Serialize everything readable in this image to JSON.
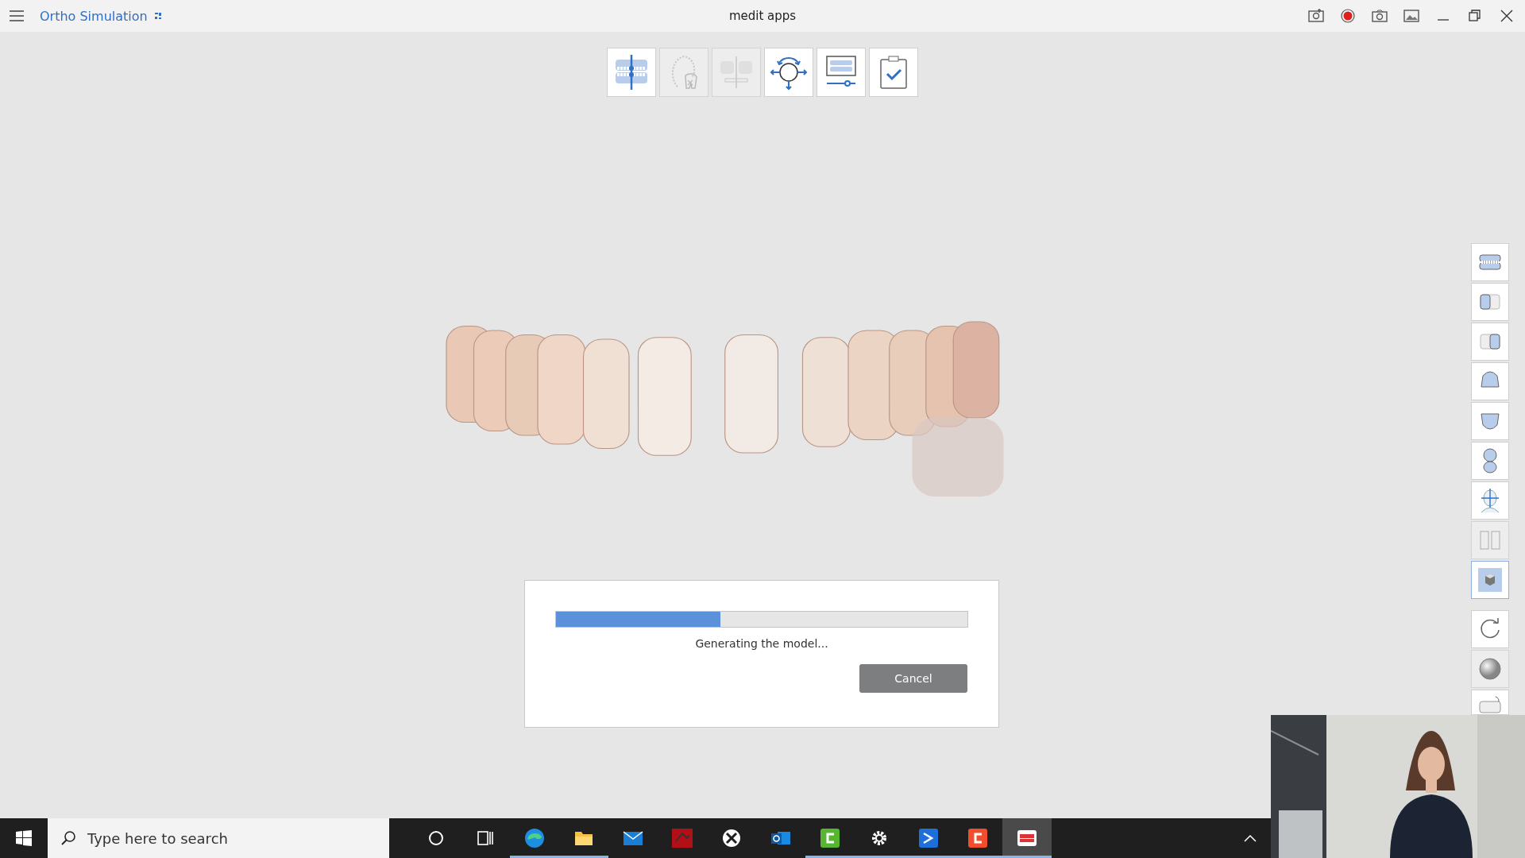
{
  "title_bar": {
    "app_name": "Ortho Simulation",
    "window_title": "medit apps"
  },
  "top_tools": [
    {
      "disabled": false
    },
    {
      "disabled": true
    },
    {
      "disabled": true
    },
    {
      "disabled": false
    },
    {
      "disabled": false
    },
    {
      "disabled": false
    }
  ],
  "view_tools": [
    {
      "selected": false,
      "disabled": false
    },
    {
      "selected": false,
      "disabled": false
    },
    {
      "selected": false,
      "disabled": false
    },
    {
      "selected": false,
      "disabled": false
    },
    {
      "selected": false,
      "disabled": false
    },
    {
      "selected": false,
      "disabled": false
    },
    {
      "selected": false,
      "disabled": false
    },
    {
      "selected": false,
      "disabled": true
    },
    {
      "selected": true,
      "disabled": false
    }
  ],
  "action_tools": [
    {
      "disabled": false
    },
    {
      "disabled": true
    },
    {
      "disabled": false
    }
  ],
  "progress_dialog": {
    "level": 0.4,
    "message": "Generating the model...",
    "cancel_button": "Cancel"
  },
  "taskbar": {
    "search": {
      "placeholder": "Type here to search"
    },
    "apps": [
      {
        "running": false,
        "selected": false
      },
      {
        "running": false,
        "selected": false
      },
      {
        "running": true,
        "selected": false
      },
      {
        "running": true,
        "selected": false
      },
      {
        "running": false,
        "selected": false
      },
      {
        "running": false,
        "selected": false
      },
      {
        "running": false,
        "selected": false
      },
      {
        "running": false,
        "selected": false
      },
      {
        "running": true,
        "selected": false
      },
      {
        "running": true,
        "selected": false
      },
      {
        "running": true,
        "selected": false
      },
      {
        "running": true,
        "selected": false
      },
      {
        "running": true,
        "selected": true
      }
    ]
  }
}
